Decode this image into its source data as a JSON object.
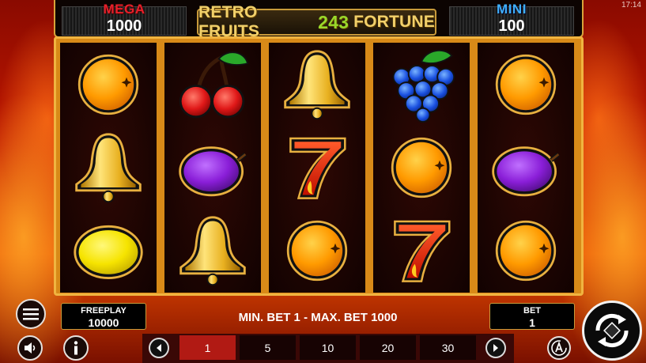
{
  "status_bar": {
    "time": "17:14"
  },
  "game": {
    "title_left": "RETRO FRUITS",
    "title_number": "243",
    "title_right": "FORTUNE"
  },
  "jackpots": {
    "mega": {
      "label": "MEGA",
      "value": "1000",
      "color": "#e8202a"
    },
    "mini": {
      "label": "MINI",
      "value": "100",
      "color": "#3fb0ff"
    }
  },
  "reels": [
    [
      "orange",
      "bell",
      "lemon"
    ],
    [
      "cherries",
      "plum",
      "bell"
    ],
    [
      "bell",
      "seven",
      "orange"
    ],
    [
      "grapes",
      "orange",
      "seven"
    ],
    [
      "orange",
      "plum",
      "orange"
    ]
  ],
  "freeplay": {
    "label": "FREEPLAY",
    "value": "10000"
  },
  "bet_range": "MIN. BET 1 - MAX. BET 1000",
  "bet": {
    "label": "BET",
    "value": "1"
  },
  "bet_options": [
    "1",
    "5",
    "10",
    "20",
    "30"
  ],
  "selected_bet": "1",
  "icons": {
    "menu": "hamburger-menu-icon",
    "sound": "speaker-icon",
    "info": "info-icon",
    "prev": "chevron-left-icon",
    "next": "chevron-right-icon",
    "autoplay": "autoplay-icon",
    "spin": "spin-icon"
  },
  "colors": {
    "frame": "#d88a18",
    "frame_border": "#f0b440",
    "title_text": "#f1d06a",
    "title_number": "#9ad82a",
    "selected_bet_bg": "#b11a14"
  }
}
